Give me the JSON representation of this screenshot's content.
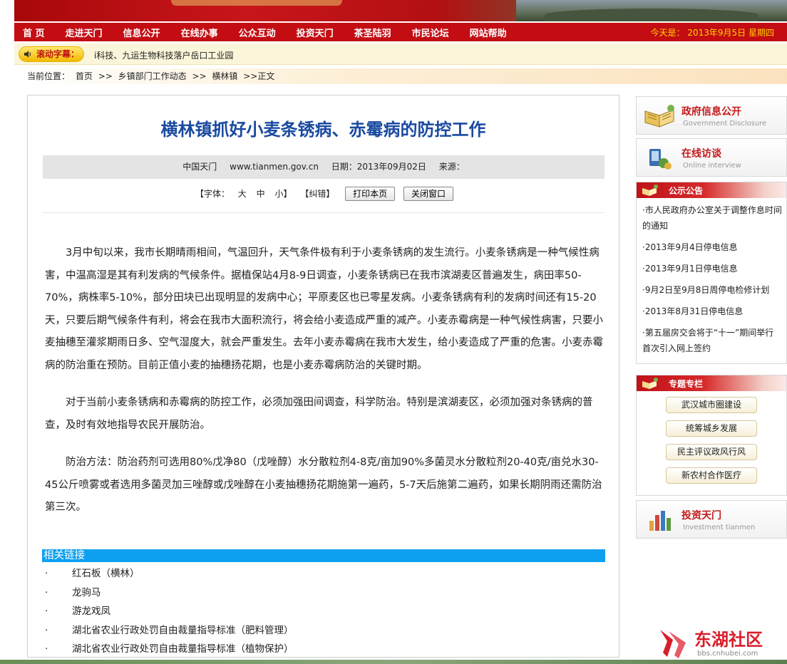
{
  "nav": {
    "items": [
      "首 页",
      "走进天门",
      "信息公开",
      "在线办事",
      "公众互动",
      "投资天门",
      "茶圣陆羽",
      "市民论坛",
      "网站帮助"
    ],
    "date": "今天是： 2013年9月5日 星期四"
  },
  "ticker": {
    "label": "滚动字幕：",
    "text": "i科技、九运生物科技落户岳口工业园"
  },
  "breadcrumb": {
    "prefix": "当前位置：",
    "items": [
      "首页",
      ">>",
      "乡镇部门工作动态",
      ">>",
      "横林镇",
      ">>正文"
    ]
  },
  "article": {
    "title": "横林镇抓好小麦条锈病、赤霉病的防控工作",
    "meta": {
      "site": "中国天门",
      "url": "www.tianmen.gov.cn",
      "date": "日期：2013年09月02日",
      "source": "来源："
    },
    "tools": {
      "font_label": "【字体：",
      "big": "大",
      "mid": "中",
      "small": "小】",
      "correct": "【纠错】",
      "print_btn": "打印本页",
      "close_btn": "关闭窗口"
    },
    "paragraphs": [
      "3月中旬以来，我市长期晴雨相间，气温回升，天气条件极有利于小麦条锈病的发生流行。小麦条锈病是一种气候性病害，中温高湿是其有利发病的气候条件。据植保站4月8-9日调查，小麦条锈病已在我市滨湖麦区普遍发生，病田率50-70%，病株率5-10%，部分田块已出现明显的发病中心；平原麦区也已零星发病。小麦条锈病有利的发病时间还有15-20天，只要后期气候条件有利，将会在我市大面积流行，将会给小麦造成严重的减产。小麦赤霉病是一种气候性病害，只要小麦抽穗至灌浆期雨日多、空气湿度大，就会严重发生。去年小麦赤霉病在我市大发生，给小麦造成了严重的危害。小麦赤霉病的防治重在预防。目前正值小麦的抽穗扬花期，也是小麦赤霉病防治的关键时期。",
      "对于当前小麦条锈病和赤霉病的防控工作，必须加强田间调查，科学防治。特别是滨湖麦区，必须加强对条锈病的普查，及时有效地指导农民开展防治。",
      "防治方法：防治药剂可选用80%戊净80（戊唑醇）水分散粒剂4-8克/亩加90%多菌灵水分散粒剂20-40克/亩兑水30-45公斤喷雾或者选用多菌灵加三唑醇或戊唑醇在小麦抽穗扬花期施第一遍药，5-7天后施第二遍药，如果长期阴雨还需防治第三次。"
    ],
    "related_title": "相关链接",
    "related_bullet": "·",
    "related": [
      "红石板（横林）",
      "龙驹马",
      "游龙戏凤",
      "湖北省农业行政处罚自由裁量指导标准（肥料管理）",
      "湖北省农业行政处罚自由裁量指导标准（植物保护）"
    ]
  },
  "sidebar": {
    "gov_info": {
      "zh": "政府信息公开",
      "en": "Government Disclosure"
    },
    "online_interview": {
      "zh": "在线访谈",
      "en": "Online interview"
    },
    "notice": {
      "title": "公示公告",
      "items": [
        "·市人民政府办公室关于调整作息时间的通知",
        "·2013年9月4日停电信息",
        "·2013年9月1日停电信息",
        "·9月2日至9月8日周停电检修计划",
        "·2013年8月31日停电信息",
        "·第五届房交会将于“十一”期间举行 首次引入网上签约"
      ]
    },
    "topics": {
      "title": "专题专栏",
      "items": [
        "武汉城市圈建设",
        "统筹城乡发展",
        "民主评议政风行风",
        "新农村合作医疗"
      ]
    },
    "invest": {
      "zh": "投资天门",
      "en": "Investment tianmen"
    }
  },
  "watermark": {
    "name": "东湖社区",
    "url": "bbs.cnhubei.com"
  },
  "colors": {
    "nav_red": "#c30d13",
    "title_blue": "#1a4aa0",
    "related_blue": "#0ea0f0",
    "date_yellow": "#ffd200"
  }
}
